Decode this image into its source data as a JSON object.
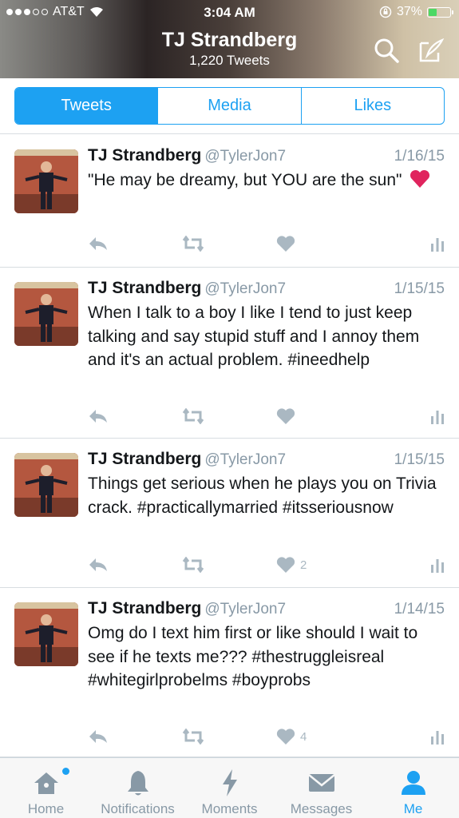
{
  "status": {
    "carrier": "AT&T",
    "time": "3:04 AM",
    "battery": "37%"
  },
  "header": {
    "title": "TJ Strandberg",
    "tweet_count": "1,220 Tweets"
  },
  "tabs": [
    {
      "label": "Tweets",
      "active": true
    },
    {
      "label": "Media",
      "active": false
    },
    {
      "label": "Likes",
      "active": false
    }
  ],
  "tweets": [
    {
      "name": "TJ Strandberg",
      "handle": "@TylerJon7",
      "date": "1/16/15",
      "text": "\"He may be dreamy, but YOU are the sun\"",
      "likes": ""
    },
    {
      "name": "TJ Strandberg",
      "handle": "@TylerJon7",
      "date": "1/15/15",
      "text": "When I talk to a boy I like I tend to just keep talking and say stupid stuff and I annoy them and it's an actual problem. #ineedhelp",
      "likes": ""
    },
    {
      "name": "TJ Strandberg",
      "handle": "@TylerJon7",
      "date": "1/15/15",
      "text": "Things get serious when he plays you on Trivia crack. #practicallymarried #itsseriousnow",
      "likes": "2"
    },
    {
      "name": "TJ Strandberg",
      "handle": "@TylerJon7",
      "date": "1/14/15",
      "text": "Omg do I text him first or like should I wait to see if he texts me??? #thestruggleisreal #whitegirlprobelms #boyprobs",
      "likes": "4"
    }
  ],
  "nav": [
    {
      "label": "Home",
      "icon": "home-icon"
    },
    {
      "label": "Notifications",
      "icon": "bell-icon"
    },
    {
      "label": "Moments",
      "icon": "lightning-icon"
    },
    {
      "label": "Messages",
      "icon": "envelope-icon"
    },
    {
      "label": "Me",
      "icon": "person-icon"
    }
  ],
  "colors": {
    "accent": "#1da1f2",
    "muted": "#8899a6",
    "heart": "#e0245e"
  }
}
